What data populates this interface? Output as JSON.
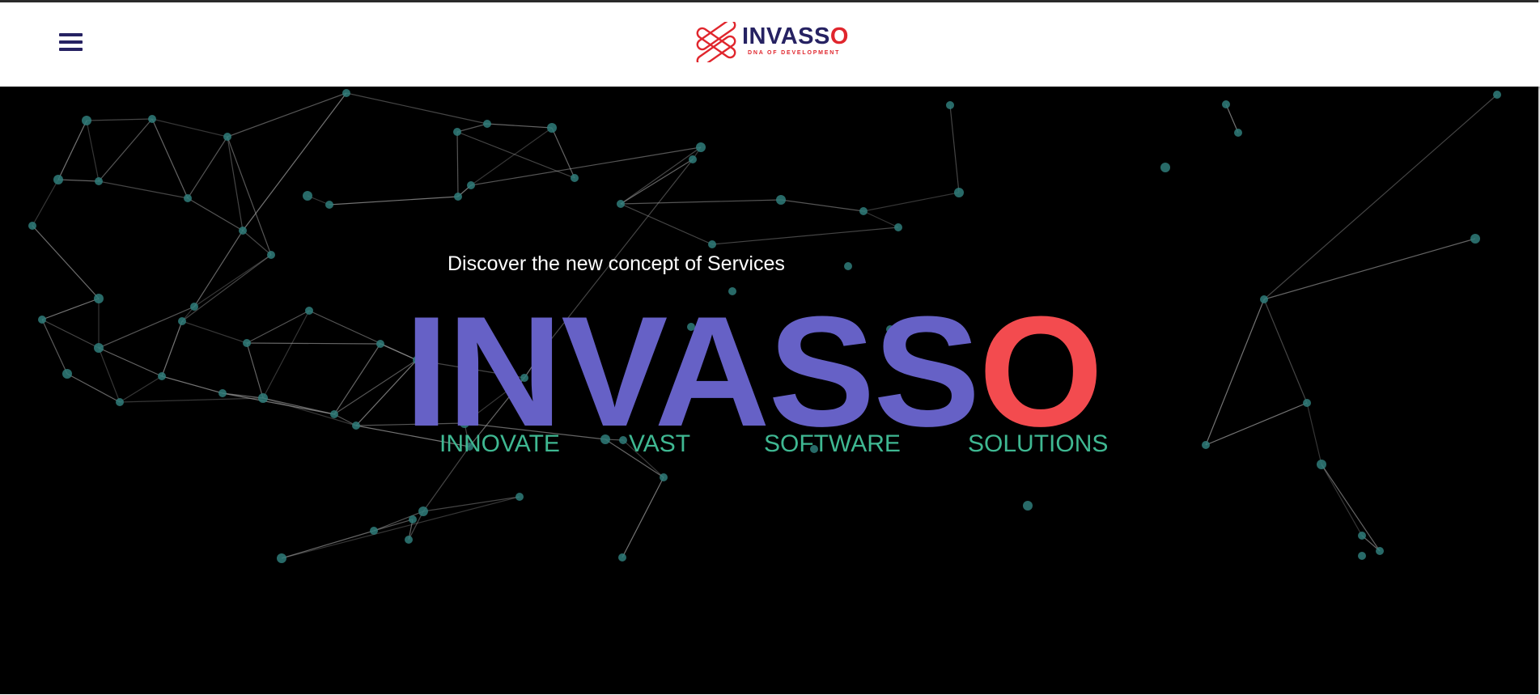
{
  "header": {
    "menu_icon": "hamburger-menu-icon",
    "logo": {
      "mark_icon": "interlinked-rings-logo-icon",
      "word_main": "INVASS",
      "word_accent": "O",
      "tagline": "DNA OF DEVELOPMENT"
    }
  },
  "hero": {
    "tagline": "Discover the new concept of Services",
    "brand_main": "INVASS",
    "brand_accent": "O",
    "acronym": [
      "INNOVATE",
      "VAST",
      "SOFTWARE",
      "SOLUTIONS"
    ],
    "background": "particle-network-animation"
  },
  "colors": {
    "brand_navy": "#262262",
    "brand_red": "#e0262d",
    "hero_purple": "#6661c6",
    "hero_red": "#f34b4f",
    "acronym_green": "#3fb892",
    "node_teal": "#2f7d7a",
    "hero_background": "#000000"
  }
}
